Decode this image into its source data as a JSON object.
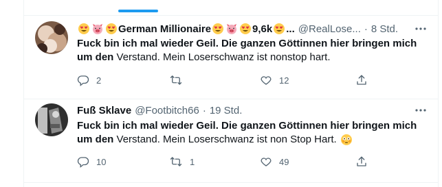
{
  "tweets": [
    {
      "name_text": "German Millionaire",
      "name_suffix": "9,6k",
      "name_ellipsis": "...",
      "handle": "@RealLose...",
      "dot": "·",
      "time": "8 Std.",
      "text_bold": "Fuck bin ich mal wieder Geil. Die ganzen Göttinnen hier bringen mich um den",
      "text_rest": " Verstand. Mein Loserschwanz ist nonstop hart.",
      "replies": "2",
      "retweets": "",
      "likes": "12"
    },
    {
      "name_text": "Fuß Sklave",
      "handle": "@Footbitch66",
      "dot": "·",
      "time": "19 Std.",
      "text_bold": "Fuck bin ich mal wieder Geil. Die ganzen Göttinnen hier bringen mich um den",
      "text_rest": " Verstand. Mein Loserschwanz ist non Stop Hart.",
      "replies": "10",
      "retweets": "1",
      "likes": "49"
    }
  ],
  "icons": {
    "reply": "reply-icon",
    "retweet": "retweet-icon",
    "like": "heart-icon",
    "share": "share-icon",
    "more": "more-icon",
    "heart_eyes": "heart-eyes-emoji-icon",
    "pig": "pig-face-emoji-icon",
    "flushed": "flushed-face-emoji-icon"
  },
  "colors": {
    "accent": "#1d9bf0",
    "text": "#0f1419",
    "secondary": "#536471",
    "border": "#eff3f4"
  }
}
